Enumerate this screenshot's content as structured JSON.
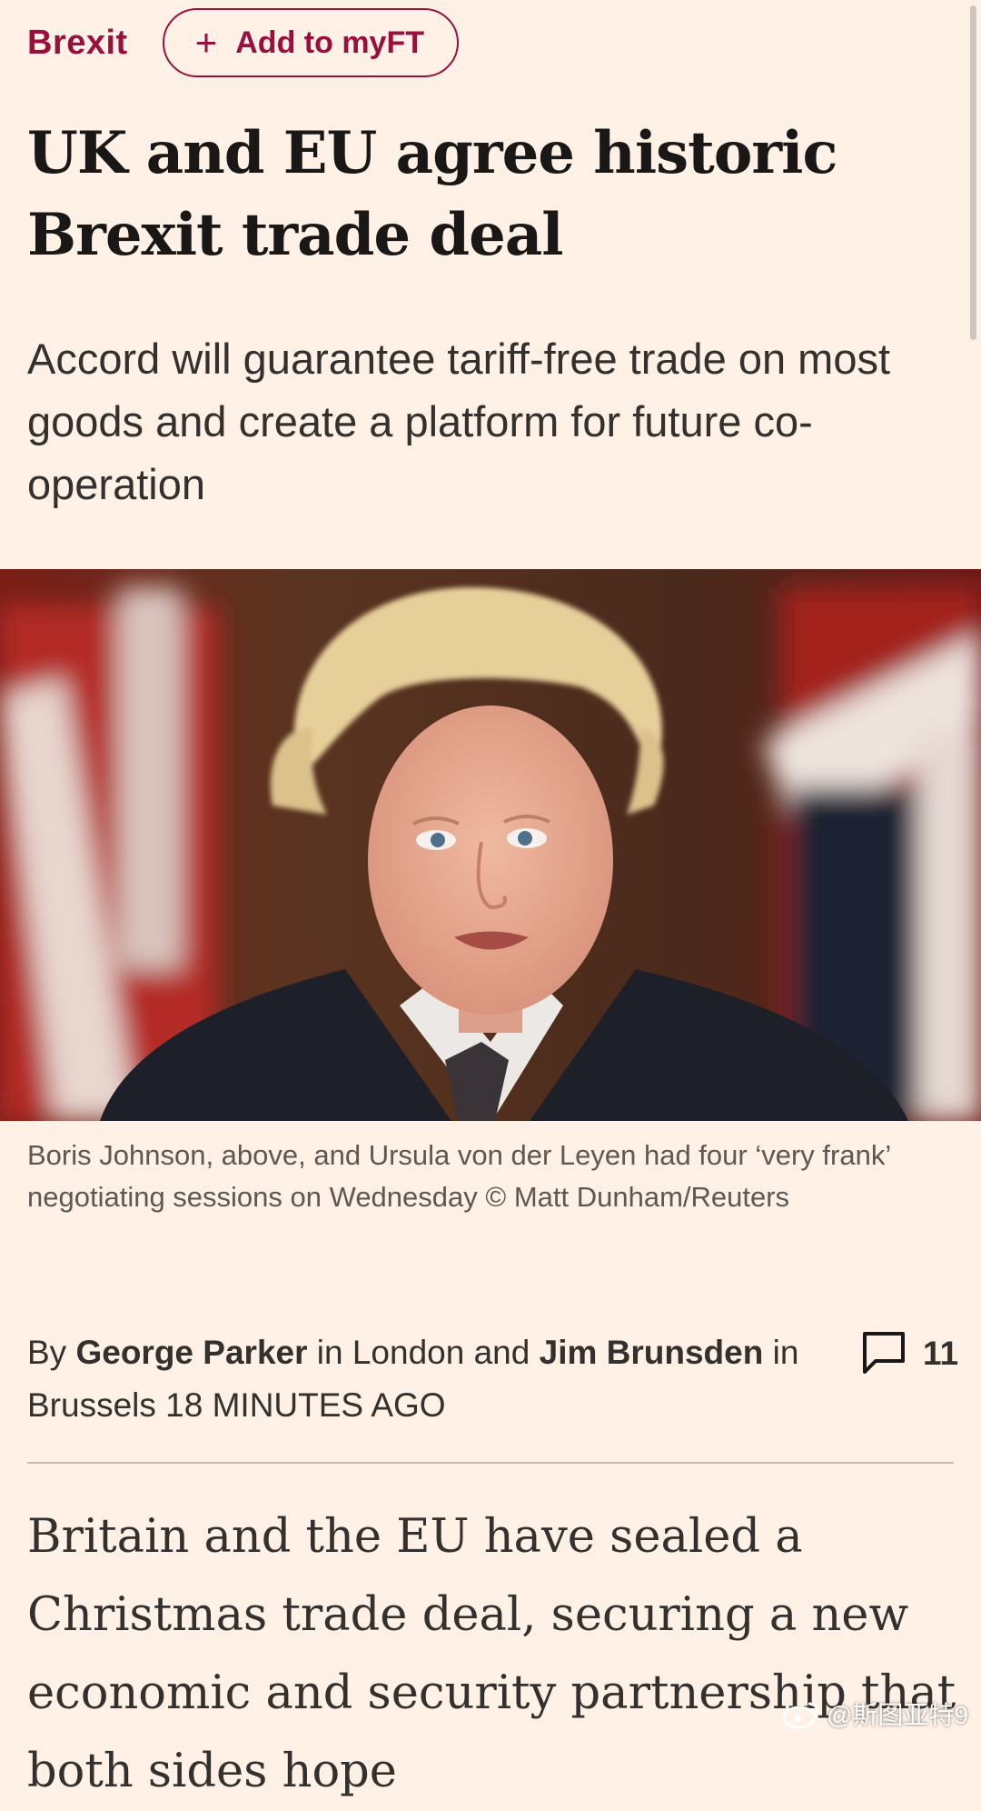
{
  "header": {
    "section": "Brexit",
    "myft_button": "Add to myFT",
    "plus_icon": "plus-icon"
  },
  "article": {
    "headline": "UK and EU agree historic Brexit trade deal",
    "standfirst": "Accord will guarantee tariff-free trade on most goods and create a platform for future co-operation",
    "image_caption": "Boris Johnson, above, and Ursula von der Leyen had four ‘very frank’ negotiating sessions on Wednesday © Matt Dunham/Reuters",
    "byline": {
      "prefix": "By",
      "author1": "George Parker",
      "mid": "in London and",
      "author2": "Jim Brunsden",
      "location2": "in Brussels",
      "time": "18 MINUTES AGO"
    },
    "comments": {
      "icon": "comment-icon",
      "count": "11"
    },
    "body": "Britain and the EU have sealed a Christmas trade deal, securing a new economic and security partnership that both sides hope"
  },
  "watermark": "@斯图亚特9",
  "colors": {
    "background": "#fff1e5",
    "accent": "#990f3d",
    "text": "#33302e"
  }
}
